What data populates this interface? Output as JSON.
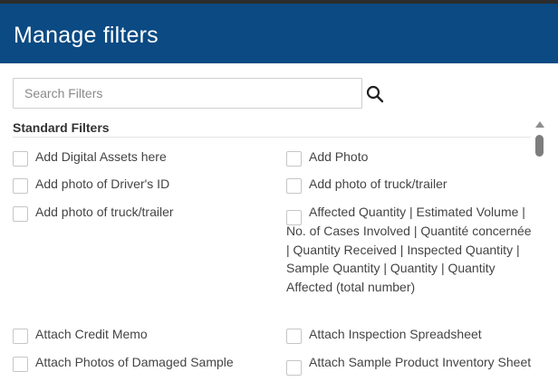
{
  "dialog": {
    "title": "Manage filters"
  },
  "search": {
    "placeholder": "Search Filters",
    "value": "",
    "icon": "search-icon"
  },
  "section": {
    "title": "Standard Filters"
  },
  "filters": {
    "left": [
      "Add Digital Assets here",
      "Add photo of Driver's ID",
      "Add photo of truck/trailer",
      "Attach Credit Memo",
      "Attach Photos of Damaged Sample"
    ],
    "right": [
      "Add Photo",
      "Add photo of truck/trailer",
      "Affected Quantity | Estimated Volume | No. of Cases Involved | Quantité concernée | Quantity Received | Inspected Quantity | Sample Quantity | Quantity | Quantity Affected (total number)",
      "Attach Inspection Spreadsheet",
      "Attach Sample Product Inventory Sheet"
    ]
  },
  "colors": {
    "header_bg": "#0b4a83",
    "header_text": "#ffffff",
    "label_text": "#444444"
  }
}
